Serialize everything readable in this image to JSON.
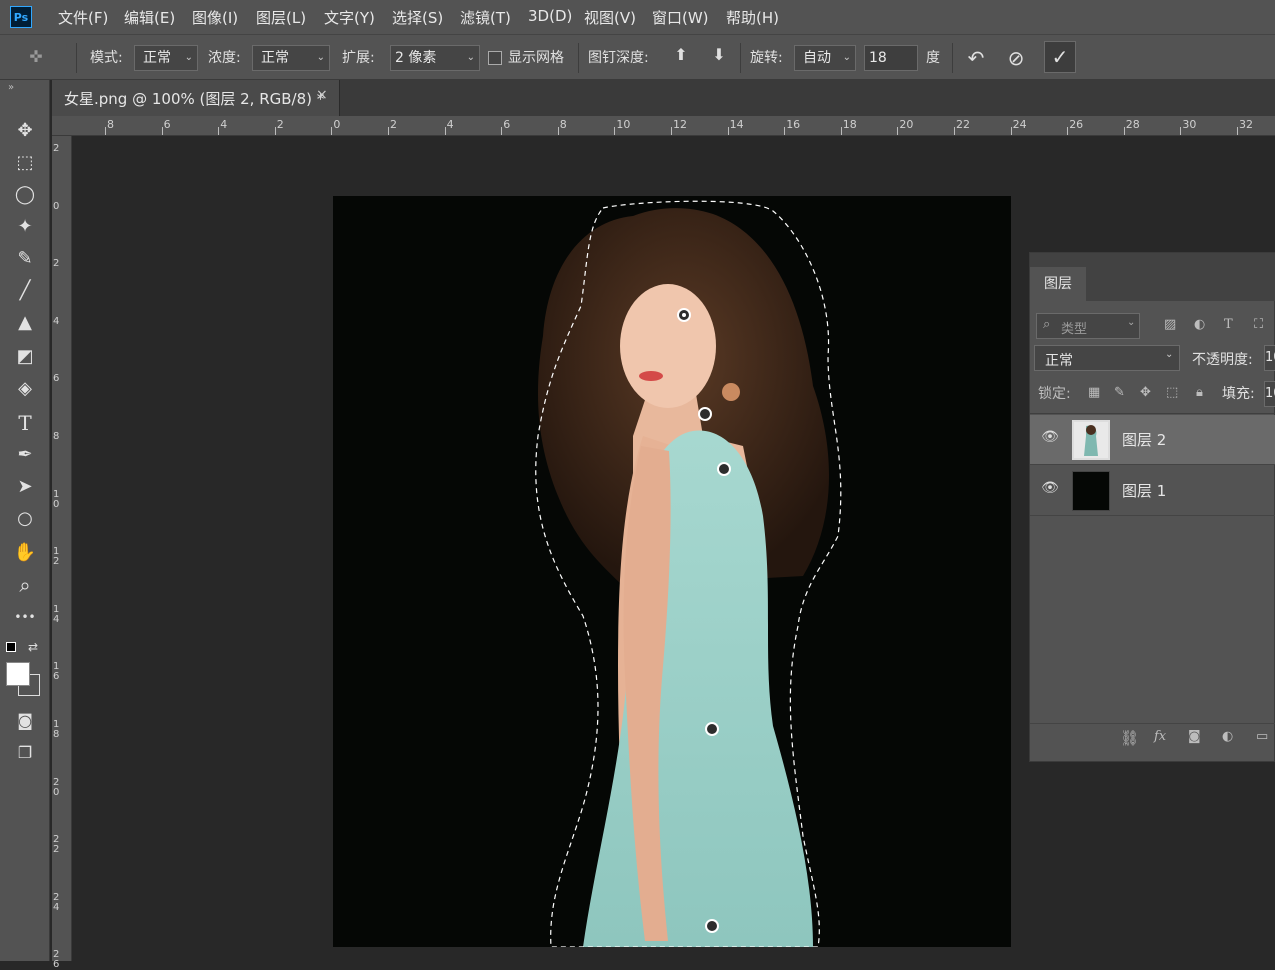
{
  "app": {
    "logo_text": "Ps"
  },
  "menu": [
    "文件(F)",
    "编辑(E)",
    "图像(I)",
    "图层(L)",
    "文字(Y)",
    "选择(S)",
    "滤镜(T)",
    "3D(D)",
    "视图(V)",
    "窗口(W)",
    "帮助(H)"
  ],
  "options": {
    "mode_label": "模式:",
    "mode_value": "正常",
    "density_label": "浓度:",
    "density_value": "正常",
    "expand_label": "扩展:",
    "expand_value": "2 像素",
    "show_mesh_label": "显示网格",
    "show_mesh_checked": false,
    "pin_depth_label": "图钉深度:",
    "rotate_label": "旋转:",
    "rotate_value": "自动",
    "angle_value": "18",
    "angle_unit": "度"
  },
  "document": {
    "tab_title": "女星.png @ 100% (图层 2, RGB/8) *",
    "close_glyph": "×"
  },
  "ruler": {
    "horizontal": [
      "8",
      "6",
      "4",
      "2",
      "0",
      "2",
      "4",
      "6",
      "8",
      "10",
      "12",
      "14",
      "16",
      "18",
      "20",
      "22",
      "24",
      "26",
      "28",
      "30",
      "32"
    ],
    "vertical": [
      "2",
      "0",
      "2",
      "4",
      "6",
      "8",
      "10",
      "12",
      "14",
      "16",
      "18",
      "20",
      "22",
      "24",
      "26"
    ]
  },
  "tools": [
    {
      "name": "move-tool-icon",
      "glyph": "✥"
    },
    {
      "name": "marquee-tool-icon",
      "glyph": "⬚"
    },
    {
      "name": "lasso-tool-icon",
      "glyph": "◯"
    },
    {
      "name": "magic-wand-tool-icon",
      "glyph": "✦"
    },
    {
      "name": "eyedropper-tool-icon",
      "glyph": "✎"
    },
    {
      "name": "brush-tool-icon",
      "glyph": "╱"
    },
    {
      "name": "stamp-tool-icon",
      "glyph": "▲"
    },
    {
      "name": "eraser-tool-icon",
      "glyph": "◩"
    },
    {
      "name": "paint-bucket-tool-icon",
      "glyph": "◈"
    },
    {
      "name": "type-tool-icon",
      "glyph": "T"
    },
    {
      "name": "pen-tool-icon",
      "glyph": "✒"
    },
    {
      "name": "path-select-tool-icon",
      "glyph": "➤"
    },
    {
      "name": "ellipse-tool-icon",
      "glyph": "○"
    },
    {
      "name": "hand-tool-icon",
      "glyph": "✋"
    },
    {
      "name": "zoom-tool-icon",
      "glyph": "⌕"
    },
    {
      "name": "more-tools-icon",
      "glyph": "•••"
    }
  ],
  "colors": {
    "foreground": "#ffffff",
    "background": "#1a1a1a",
    "canvas_bg": "#050705",
    "accent": "#31a8ff"
  },
  "layers_panel": {
    "tab_label": "图层",
    "search_placeholder": "类型",
    "blend_mode": "正常",
    "opacity_label": "不透明度:",
    "opacity_value": "10",
    "lock_label": "锁定:",
    "fill_label": "填充:",
    "fill_value": "10",
    "layers": [
      {
        "name": "图层 2",
        "selected": true,
        "visible": true
      },
      {
        "name": "图层 1",
        "selected": false,
        "visible": true
      }
    ]
  }
}
